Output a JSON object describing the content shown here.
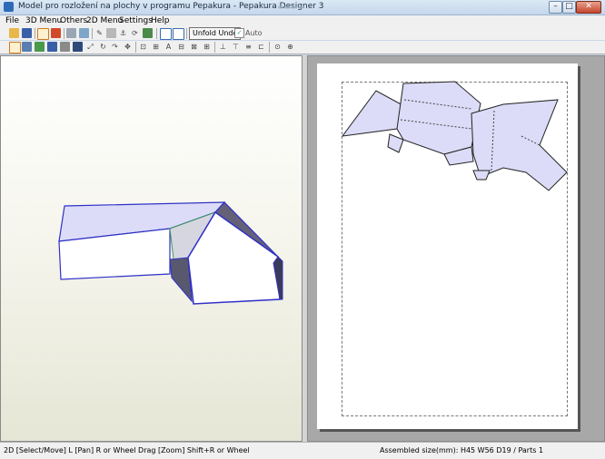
{
  "window": {
    "title": "Model pro rozložení na plochy v programu Pepakura - Pepakura Designer 3",
    "buttons": {
      "minimize": "–",
      "maximize": "□",
      "close": "✕"
    }
  },
  "menu": {
    "file": "File",
    "menu3d": "3D Menu",
    "others": "Others",
    "menu2d": "2D Menu",
    "settings": "Settings",
    "help": "Help"
  },
  "toolbar": {
    "unfold_undo": "Unfold Undo",
    "auto_label": "Auto",
    "auto_checked": true,
    "icons_row1": [
      "open-icon",
      "save-icon",
      "select-mode-icon",
      "unfold-icon",
      "texture-icon",
      "shading-icon",
      "pen-icon",
      "cylinder-icon",
      "anchor-icon",
      "rotate-icon",
      "face-color-icon",
      "frame-icon",
      "frame2-icon"
    ],
    "icons_row2": [
      "select-icon",
      "layout-icon",
      "edge-icon",
      "flap-icon",
      "image-icon",
      "rotate-part-icon",
      "join-icon",
      "split-icon",
      "flip-icon",
      "move-icon",
      "arrange-icon",
      "scale-icon",
      "text-icon",
      "align-left-icon",
      "align-center-icon",
      "align-right-icon",
      "align-bottom-icon",
      "zoom-icon",
      "zoom-fit-icon"
    ]
  },
  "status": {
    "hint": "2D [Select/Move] L [Pan] R or Wheel Drag [Zoom] Shift+R or Wheel",
    "assembled": "Assembled size(mm): H45 W56 D19 / Parts 1"
  },
  "colors": {
    "face_fill": "#dcdcf8",
    "edge_color": "#3030c8",
    "dark_face": "#606078",
    "paper": "#ffffff",
    "pane_bg": "#a8a8a8"
  }
}
